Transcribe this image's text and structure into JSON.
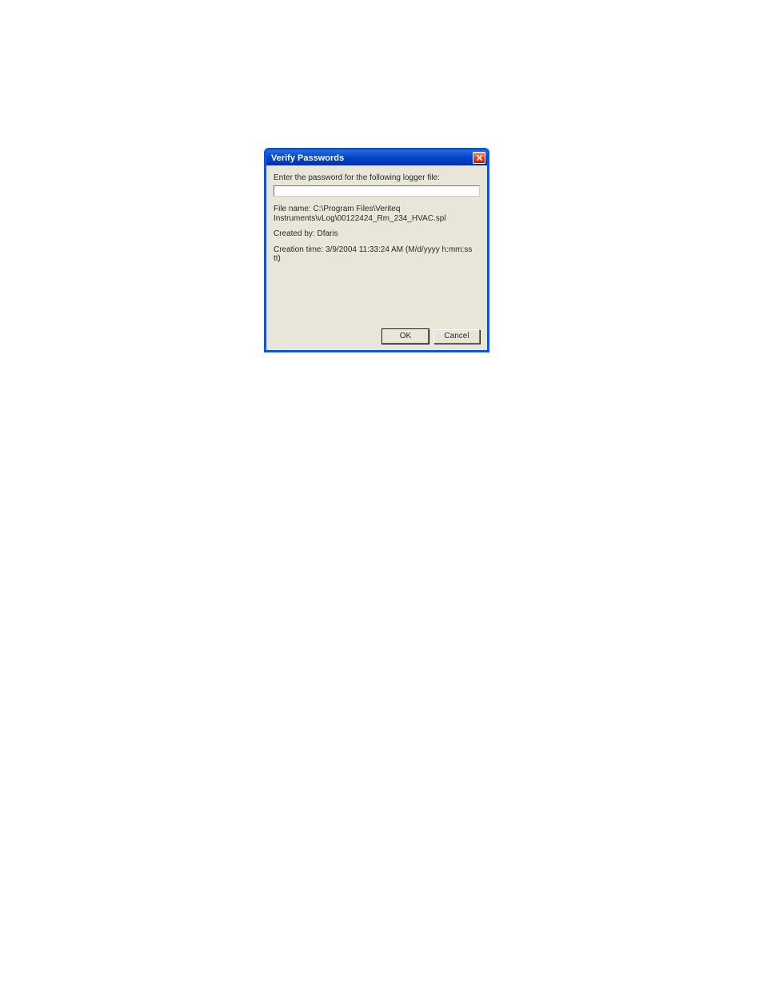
{
  "dialog": {
    "title": "Verify Passwords",
    "prompt": "Enter the password for the following logger file:",
    "password_value": "",
    "filename_label": "File name: C:\\Program Files\\Veriteq Instruments\\vLog\\00122424_Rm_234_HVAC.spl",
    "created_by_label": "Created by: Dfaris",
    "creation_time_label": "Creation time: 3/9/2004 11:33:24 AM (M/d/yyyy h:mm:ss tt)",
    "buttons": {
      "ok": "OK",
      "cancel": "Cancel"
    }
  }
}
